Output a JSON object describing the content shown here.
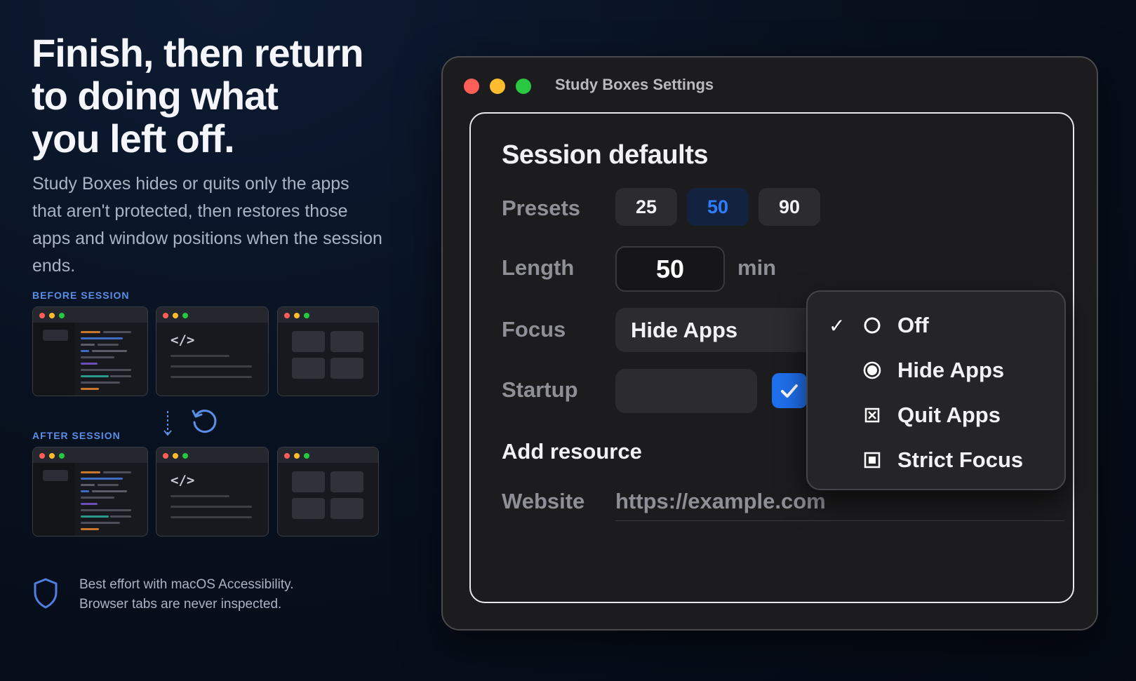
{
  "hero": {
    "headline_line1": "Finish, then return",
    "headline_line2": "to doing what",
    "headline_line3": "you left off.",
    "description": "Study Boxes hides or quits only the apps that aren't protected, then restores those apps and window positions when the session ends."
  },
  "illustration": {
    "before_label": "BEFORE SESSION",
    "after_label": "AFTER SESSION",
    "code_glyph": "</>",
    "icons": [
      "arrow-down-icon",
      "refresh-icon"
    ]
  },
  "footnote": {
    "icon": "shield-icon",
    "line1": "Best effort with macOS Accessibility.",
    "line2": "Browser tabs are never inspected."
  },
  "window": {
    "title": "Study Boxes Settings",
    "colors": {
      "close": "#ff5f57",
      "minimize": "#febc2e",
      "zoom": "#28c840",
      "accent": "#1f6feb"
    }
  },
  "settings": {
    "title": "Session defaults",
    "presets_label": "Presets",
    "presets": [
      {
        "label": "25",
        "active": false
      },
      {
        "label": "50",
        "active": true
      },
      {
        "label": "90",
        "active": false
      }
    ],
    "length_label": "Length",
    "length_value": "50",
    "length_unit": "min",
    "focus_label": "Focus",
    "focus_value": "Hide Apps",
    "startup_label": "Startup",
    "startup_checked": true,
    "add_resource_title": "Add resource",
    "website_label": "Website",
    "website_placeholder": "https://example.com"
  },
  "focus_menu": {
    "items": [
      {
        "label": "Off",
        "icon": "circle-outline-icon",
        "checked": true
      },
      {
        "label": "Hide Apps",
        "icon": "radio-filled-icon",
        "checked": false
      },
      {
        "label": "Quit Apps",
        "icon": "box-x-icon",
        "checked": false
      },
      {
        "label": "Strict Focus",
        "icon": "box-filled-icon",
        "checked": false
      }
    ],
    "check_glyph": "✓"
  }
}
